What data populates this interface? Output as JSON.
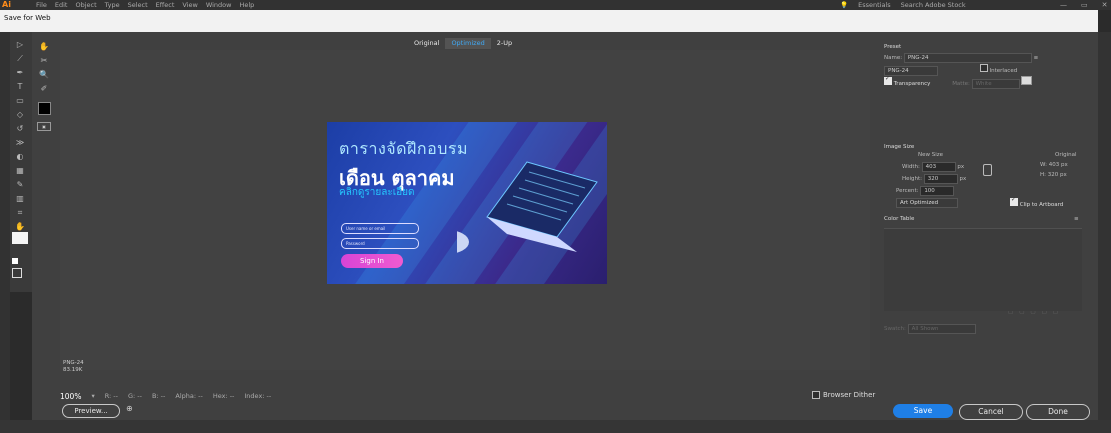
{
  "ai_menubar": {
    "logo": "Ai",
    "menus": [
      "File",
      "Edit",
      "Object",
      "Type",
      "Select",
      "Effect",
      "View",
      "Window",
      "Help"
    ],
    "workspace": "Essentials",
    "search_placeholder": "Search Adobe Stock",
    "window_controls": [
      "—",
      "▭",
      "✕"
    ]
  },
  "dialog": {
    "title": "Save for Web",
    "tabs": [
      {
        "label": "Original",
        "active": false
      },
      {
        "label": "Optimized",
        "active": true
      },
      {
        "label": "2-Up",
        "active": false
      }
    ],
    "format_info": {
      "format": "PNG-24",
      "size": "83.19K"
    },
    "zoom": "100%",
    "readouts": [
      "R: --",
      "G: --",
      "B: --",
      "Alpha: --",
      "Hex: --",
      "Index: --"
    ],
    "preview_button": "Preview...",
    "browser_dither_label": "Browser Dither"
  },
  "artwork": {
    "title_thai": "ตารางจัดฝึกอบรม",
    "month_thai": "เดือน ตุลาคม",
    "subtitle_thai": "คลิกดูรายละเอียด",
    "username_placeholder": "User name or email",
    "password_placeholder": "Password",
    "signin_label": "Sign In"
  },
  "right_panel": {
    "preset_label": "Preset",
    "name_label": "Name:",
    "name_value": "PNG-24",
    "format_value": "PNG-24",
    "interlaced_label": "Interlaced",
    "transparency_label": "Transparency",
    "matte_label": "Matte:",
    "matte_value": "White",
    "image_size_label": "Image Size",
    "new_size_label": "New Size",
    "original_label": "Original",
    "width_label": "Width:",
    "width_value": "403",
    "height_label": "Height:",
    "height_value": "320",
    "unit": "px",
    "original_width": "W: 403 px",
    "original_height": "H: 320 px",
    "percent_label": "Percent:",
    "percent_value": "100",
    "quality_value": "Art Optimized",
    "clip_label": "Clip to Artboard",
    "color_table_label": "Color Table",
    "swatch_label": "Swatch:",
    "swatch_value": "All Shown"
  },
  "buttons": {
    "save": "Save",
    "cancel": "Cancel",
    "done": "Done"
  },
  "colors": {
    "accent": "#1f7fe6",
    "signin": "#e04fd4",
    "art_bg": "#2d4fbf"
  }
}
